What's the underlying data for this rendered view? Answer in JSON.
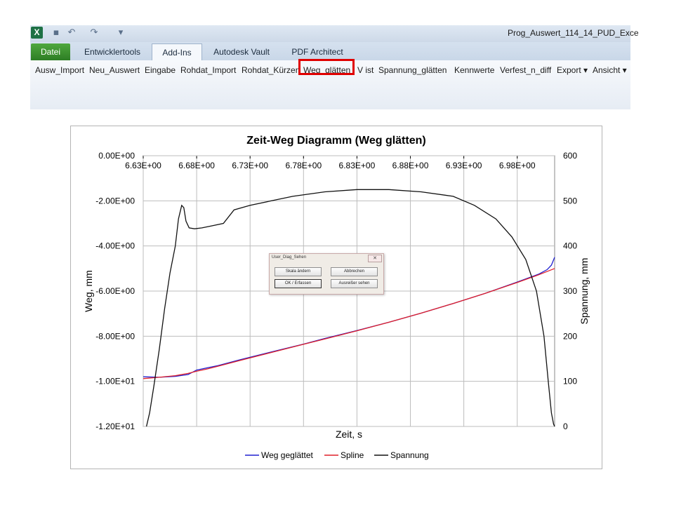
{
  "window": {
    "title": "Prog_Auswert_114_14_PUD_Exce",
    "logo": "X"
  },
  "quick_access": {
    "icons": [
      "save-icon",
      "undo-icon",
      "redo-icon",
      "customize-icon"
    ],
    "glyphs": [
      "▪",
      "↶",
      "↷",
      "▾"
    ]
  },
  "tabs": [
    {
      "label": "Datei"
    },
    {
      "label": "Entwicklertools"
    },
    {
      "label": "Add-Ins"
    },
    {
      "label": "Autodesk Vault"
    },
    {
      "label": "PDF Architect"
    }
  ],
  "ribbon": {
    "items": [
      {
        "label": "Ausw_Import"
      },
      {
        "label": "Neu_Auswert"
      },
      {
        "label": "Eingabe"
      },
      {
        "label": "Rohdat_Import"
      },
      {
        "label": "Rohdat_Kürzen"
      },
      {
        "label": "Weg_glätten"
      },
      {
        "label": "V ist"
      },
      {
        "label": "Spannung_glätten"
      },
      {
        "label": "Kennwerte"
      },
      {
        "label": "Verfest_n_diff"
      },
      {
        "label": "Export ▾"
      },
      {
        "label": "Ansicht ▾"
      }
    ],
    "highlight_color": "#e00000"
  },
  "dialog": {
    "title": "User_Diag_Sehen",
    "close": "✕",
    "buttons": {
      "scale": "Skala ändern",
      "cancel": "Abbrechen",
      "ok": "OK / Erfassen",
      "outliers": "Ausreißer sehen"
    }
  },
  "chart_data": {
    "type": "line",
    "title": "Zeit-Weg Diagramm (Weg glätten)",
    "xlabel": "Zeit, s",
    "ylabel": "Weg, mm",
    "y2label": "Spannung, mm",
    "xlim": [
      6.63,
      7.015
    ],
    "xticks": [
      "6.63E+00",
      "6.68E+00",
      "6.73E+00",
      "6.78E+00",
      "6.83E+00",
      "6.88E+00",
      "6.93E+00",
      "6.98E+00"
    ],
    "xtick_values": [
      6.63,
      6.68,
      6.73,
      6.78,
      6.83,
      6.88,
      6.93,
      6.98
    ],
    "ylim": [
      -12,
      0
    ],
    "yticks": [
      "0.00E+00",
      "-2.00E+00",
      "-4.00E+00",
      "-6.00E+00",
      "-8.00E+00",
      "-1.00E+01",
      "-1.20E+01"
    ],
    "ytick_values": [
      0,
      -2,
      -4,
      -6,
      -8,
      -10,
      -12
    ],
    "y2lim": [
      0,
      600
    ],
    "y2ticks": [
      "600",
      "500",
      "400",
      "300",
      "200",
      "100",
      "0"
    ],
    "y2tick_values": [
      600,
      500,
      400,
      300,
      200,
      100,
      0
    ],
    "grid": true,
    "legend": "bottom",
    "series": [
      {
        "name": "Weg geglättet",
        "color": "#2020d0",
        "axis": "left",
        "x": [
          6.63,
          6.645,
          6.66,
          6.672,
          6.68,
          6.69,
          6.7,
          6.72,
          6.75,
          6.78,
          6.8,
          6.83,
          6.86,
          6.89,
          6.92,
          6.95,
          6.98,
          7.0,
          7.008,
          7.012,
          7.015
        ],
        "y": [
          -9.8,
          -9.82,
          -9.78,
          -9.7,
          -9.5,
          -9.4,
          -9.3,
          -9.05,
          -8.7,
          -8.35,
          -8.1,
          -7.75,
          -7.38,
          -6.98,
          -6.55,
          -6.1,
          -5.6,
          -5.25,
          -5.05,
          -4.85,
          -4.5
        ]
      },
      {
        "name": "Spline",
        "color": "#e0202a",
        "axis": "left",
        "x": [
          6.63,
          6.645,
          6.66,
          6.672,
          6.68,
          6.69,
          6.7,
          6.72,
          6.75,
          6.78,
          6.8,
          6.83,
          6.86,
          6.89,
          6.92,
          6.95,
          6.98,
          7.0,
          7.015
        ],
        "y": [
          -9.88,
          -9.82,
          -9.75,
          -9.65,
          -9.55,
          -9.45,
          -9.33,
          -9.08,
          -8.72,
          -8.36,
          -8.12,
          -7.76,
          -7.38,
          -6.98,
          -6.55,
          -6.1,
          -5.62,
          -5.28,
          -5.0
        ]
      },
      {
        "name": "Spannung",
        "color": "#111111",
        "axis": "right",
        "x": [
          6.633,
          6.636,
          6.64,
          6.645,
          6.65,
          6.655,
          6.66,
          6.663,
          6.666,
          6.668,
          6.67,
          6.673,
          6.678,
          6.685,
          6.695,
          6.705,
          6.715,
          6.73,
          6.75,
          6.77,
          6.8,
          6.83,
          6.86,
          6.89,
          6.92,
          6.94,
          6.96,
          6.975,
          6.988,
          6.998,
          7.005,
          7.009,
          7.012,
          7.014,
          7.015
        ],
        "y": [
          0,
          30,
          90,
          170,
          260,
          340,
          400,
          460,
          490,
          485,
          455,
          440,
          438,
          440,
          445,
          450,
          480,
          490,
          500,
          510,
          520,
          525,
          525,
          520,
          510,
          490,
          460,
          420,
          370,
          300,
          200,
          100,
          30,
          5,
          0
        ]
      }
    ]
  }
}
